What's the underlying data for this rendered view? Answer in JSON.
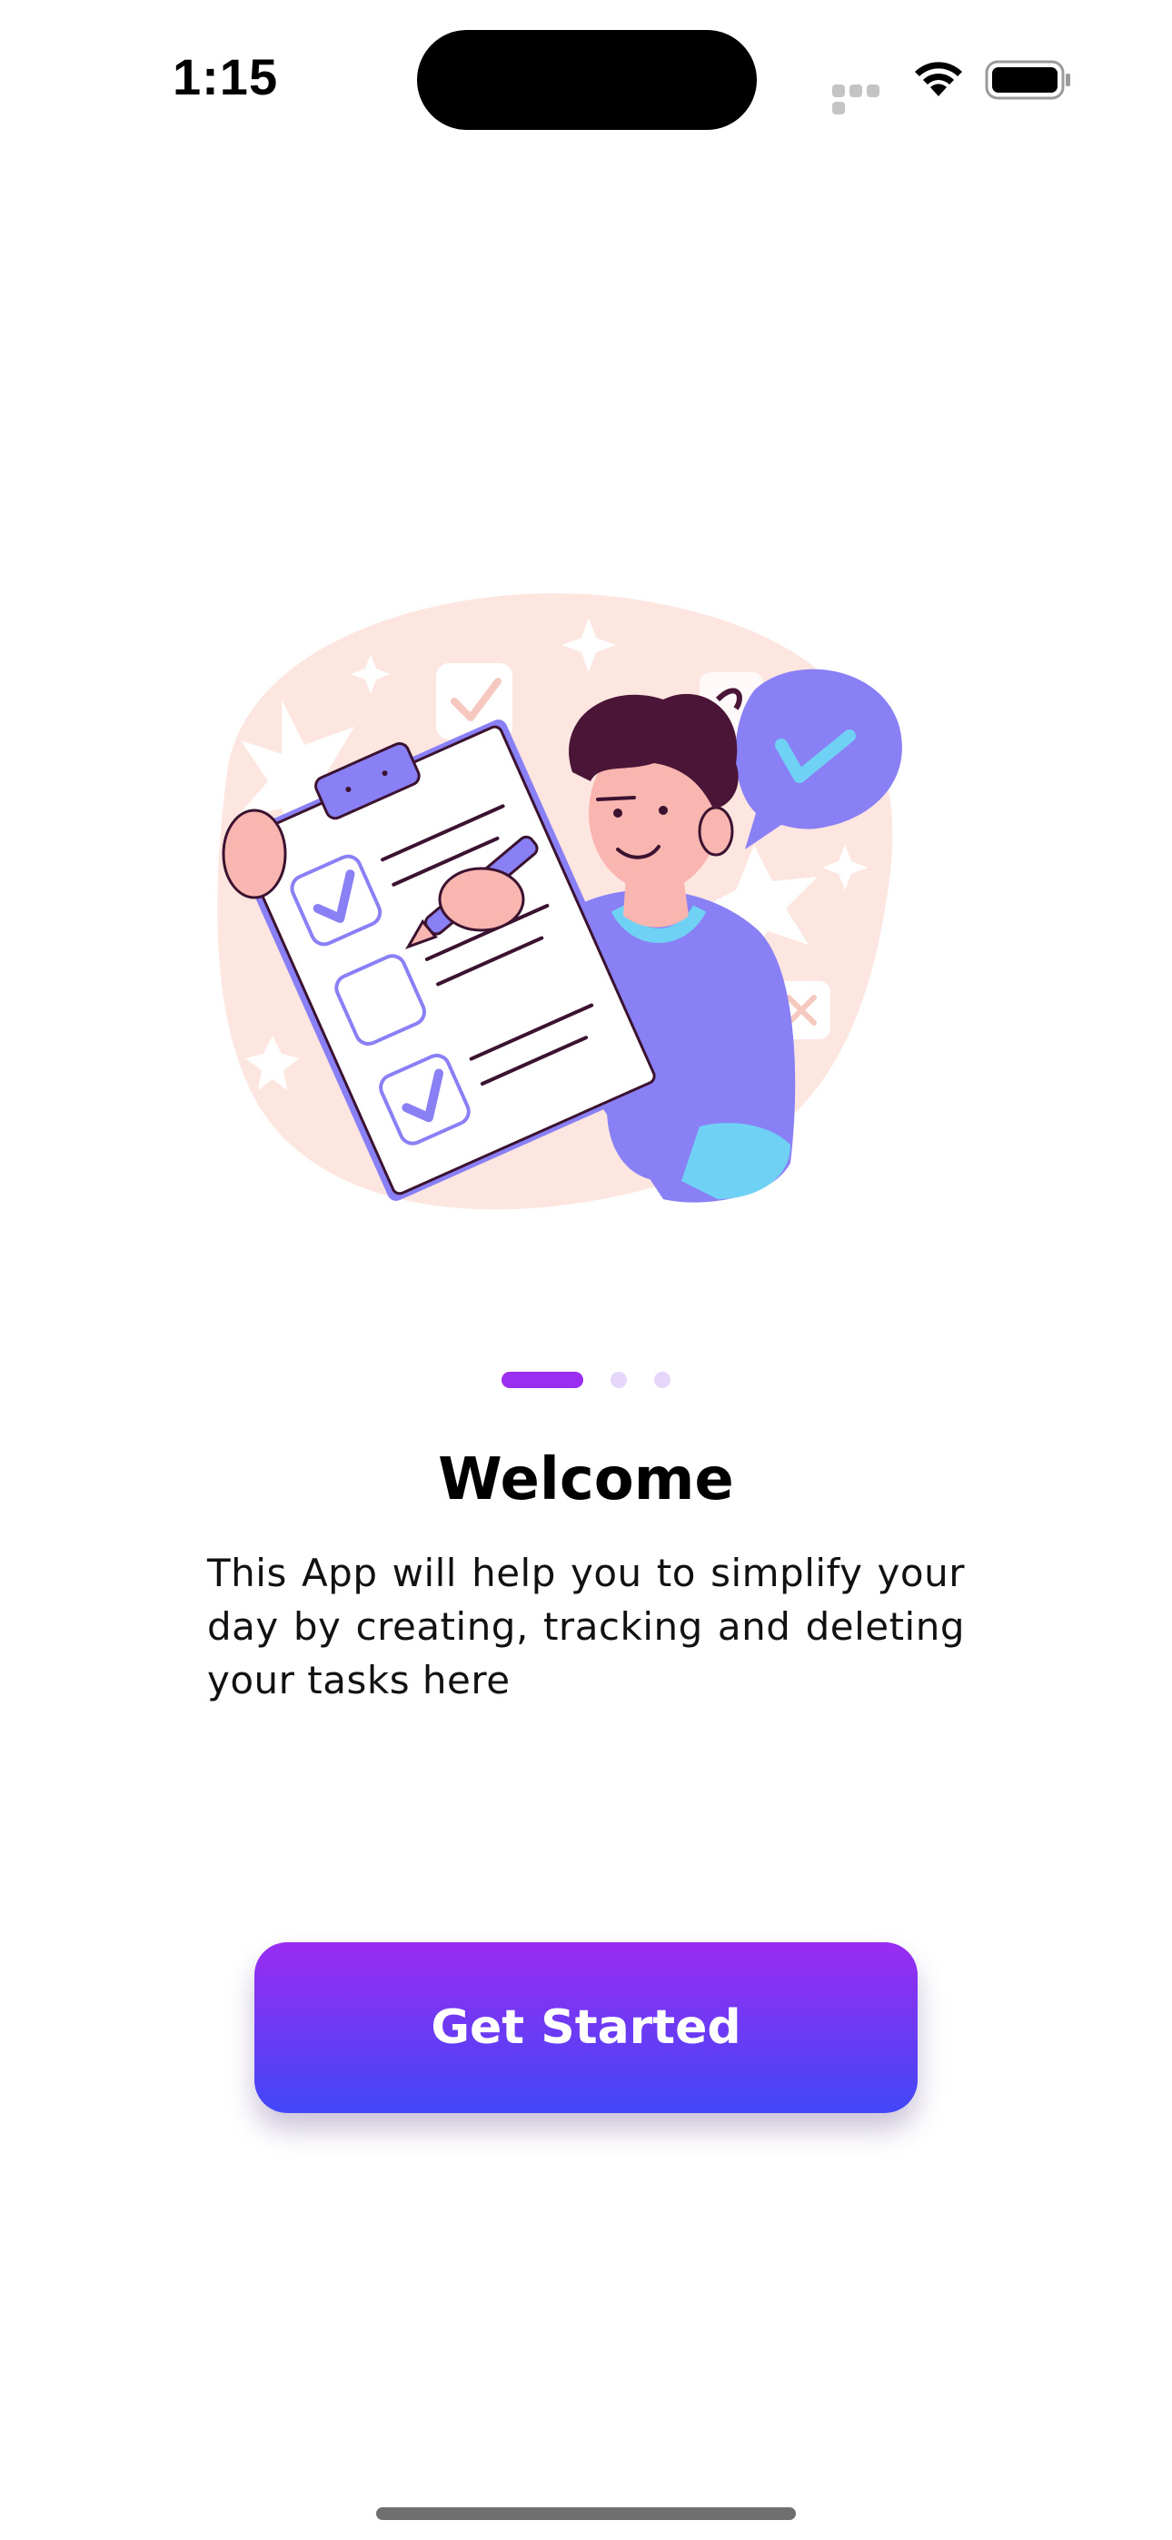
{
  "status_bar": {
    "time": "1:15"
  },
  "onboarding": {
    "illustration": "person-with-checklist-clipboard",
    "pager": {
      "total_pages": 3,
      "active_index": 0
    },
    "title": "Welcome",
    "description": "This App will help you to simplify your day by creating, tracking and deleting your tasks here",
    "cta_label": "Get Started"
  },
  "colors": {
    "accent_purple": "#9a2cf0",
    "accent_blue": "#4147f8",
    "pager_inactive": "#e6d6fb",
    "illustration_blob": "#fde6df",
    "illustration_violet": "#8a80f6"
  },
  "icons": [
    "wifi-icon",
    "battery-icon",
    "cellular-signal-icon",
    "checkmark-icon"
  ]
}
